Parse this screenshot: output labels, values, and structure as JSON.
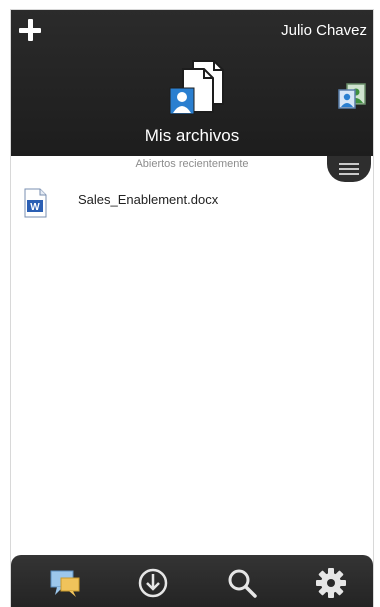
{
  "header": {
    "user_name": "Julio Chavez",
    "title": "Mis archivos"
  },
  "section": {
    "recent_label": "Abiertos recientemente"
  },
  "files": [
    {
      "name": "Sales_Enablement.docx",
      "icon": "word-doc-icon"
    }
  ],
  "icons": {
    "add": "plus-icon",
    "files": "my-files-icon",
    "share": "shared-with-me-icon",
    "menu": "menu-lines-icon",
    "chat": "chat-icon",
    "download": "download-icon",
    "search": "search-icon",
    "settings": "gear-icon"
  },
  "colors": {
    "header_bg": "#222222",
    "accent_blue": "#2a7fd0"
  }
}
